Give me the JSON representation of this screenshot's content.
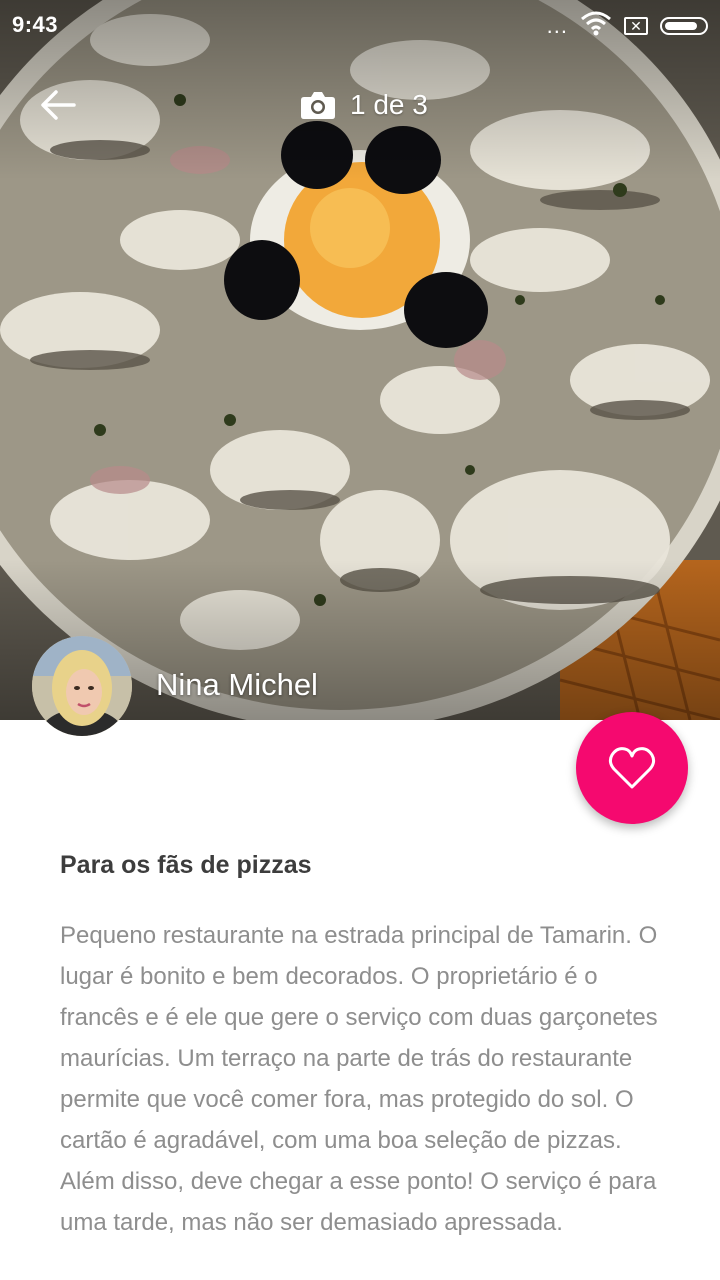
{
  "status_bar": {
    "time": "9:43",
    "signal_dots": "...",
    "battery_level": 0.85,
    "icons": [
      "wifi-icon",
      "sim-icon",
      "battery-icon"
    ]
  },
  "app_bar": {
    "back_icon": "arrow-left-icon",
    "photo_icon": "camera-icon",
    "photo_counter": "1 de 3"
  },
  "author": {
    "name": "Nina Michel"
  },
  "favorite": {
    "icon": "heart-icon",
    "color": "#f5096f"
  },
  "review": {
    "title": "Para os fãs de pizzas",
    "body": "Pequeno restaurante na estrada principal de Tamarin. O lugar é bonito e bem decorados. O proprietário é o francês e é ele que gere o serviço com duas garçonetes maurícias. Um terraço na parte de trás do restaurante permite que você comer fora, mas protegido do sol. O cartão é agradável, com uma boa seleção de pizzas. Além disso, deve chegar a esse ponto! O serviço é para uma tarde, mas não ser demasiado apressada."
  }
}
